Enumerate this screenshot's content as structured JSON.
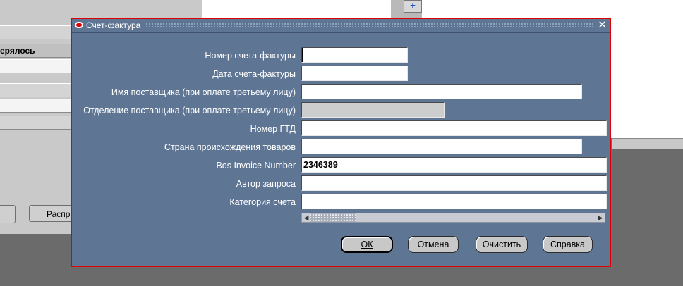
{
  "background": {
    "rows": [
      "ерялось",
      "",
      "",
      "",
      ""
    ],
    "button_left": "",
    "button_right": "Распр",
    "toolbar_icon": "+"
  },
  "dialog": {
    "title": "Счет-фактура",
    "close_glyph": "✕",
    "fields": [
      {
        "label": "Номер счета-фактуры",
        "value": ""
      },
      {
        "label": "Дата счета-фактуры",
        "value": ""
      },
      {
        "label": "Имя поставщика (при оплате третьему лицу)",
        "value": ""
      },
      {
        "label": "Отделение поставщика (при оплате третьему лицу)",
        "value": ""
      },
      {
        "label": "Номер ГТД",
        "value": ""
      },
      {
        "label": "Страна происхождения товаров",
        "value": ""
      },
      {
        "label": "Bos Invoice Number",
        "value": "2346389"
      },
      {
        "label": "Автор запроса",
        "value": ""
      },
      {
        "label": "Категория счета",
        "value": ""
      }
    ],
    "scroll_left": "◀",
    "scroll_right": "▶",
    "buttons": {
      "ok": "ОК",
      "cancel": "Отмена",
      "clear": "Очистить",
      "help": "Справка"
    }
  }
}
